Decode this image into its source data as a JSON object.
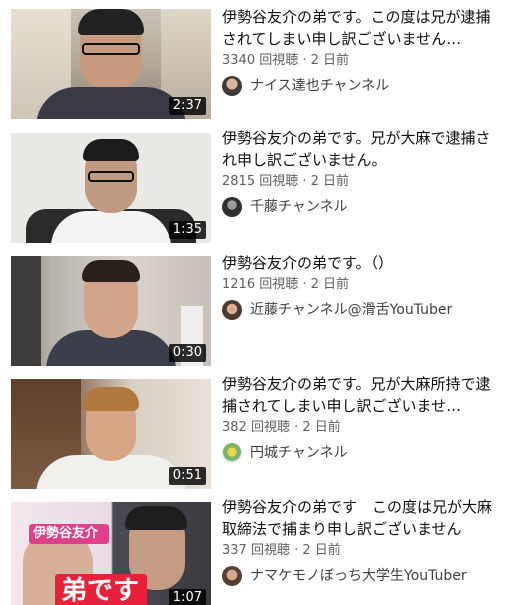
{
  "videos": [
    {
      "title": "伊勢谷友介の弟です。この度は兄が逮捕されてしまい申し訳ございません…",
      "views": "3340 回視聴",
      "age": "2 日前",
      "duration": "2:37",
      "channel": "ナイス達也チャンネル"
    },
    {
      "title": "伊勢谷友介の弟です。兄が大麻で逮捕され申し訳ございません。",
      "views": "2815 回視聴",
      "age": "2 日前",
      "duration": "1:35",
      "channel": "千藤チャンネル"
    },
    {
      "title": "伊勢谷友介の弟です。（）",
      "views": "1216 回視聴",
      "age": "2 日前",
      "duration": "0:30",
      "channel": "近藤チャンネル@滑舌YouTuber"
    },
    {
      "title": "伊勢谷友介の弟です。兄が大麻所持で逮捕されてしまい申し訳ございませ…",
      "views": "382 回視聴",
      "age": "2 日前",
      "duration": "0:51",
      "channel": "円城チャンネル"
    },
    {
      "title": "伊勢谷友介の弟です　この度は兄が大麻取締法で捕まり申し訳ございません",
      "views": "337 回視聴",
      "age": "2 日前",
      "duration": "1:07",
      "channel": "ナマケモノぼっち大学生YouTuber",
      "thumb_text_top": "伊勢谷友介",
      "thumb_text_big": "弟です"
    }
  ],
  "separator": "·",
  "colors": {
    "meta_text": "#606060",
    "title_text": "#0f0f0f",
    "duration_bg": "#000000",
    "thumb_badge_pink": "#e0408a",
    "thumb_badge_red": "#e8203a"
  }
}
